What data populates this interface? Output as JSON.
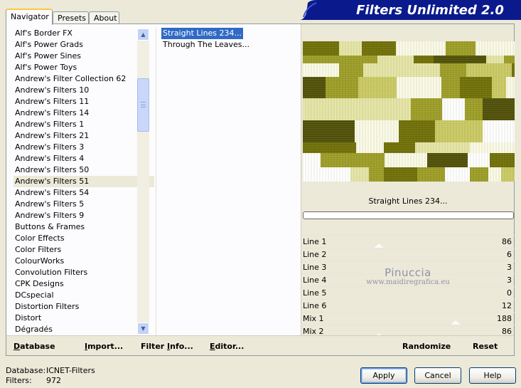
{
  "app": {
    "title": "Filters Unlimited 2.0"
  },
  "tabs": [
    {
      "label": "Navigator",
      "active": true
    },
    {
      "label": "Presets",
      "active": false
    },
    {
      "label": "About",
      "active": false
    }
  ],
  "filters": {
    "selected": "Andrew's Filters 51",
    "items": [
      "Alf's Border FX",
      "Alf's Power Grads",
      "Alf's Power Sines",
      "Alf's Power Toys",
      "Andrew's Filter Collection 62",
      "Andrew's Filters 10",
      "Andrew's Filters 11",
      "Andrew's Filters 14",
      "Andrew's Filters 1",
      "Andrew's Filters 21",
      "Andrew's Filters 3",
      "Andrew's Filters 4",
      "Andrew's Filters 50",
      "Andrew's Filters 51",
      "Andrew's Filters 54",
      "Andrew's Filters 5",
      "Andrew's Filters 9",
      "Buttons & Frames",
      "Color Effects",
      "Color Filters",
      "ColourWorks",
      "Convolution Filters",
      "CPK Designs",
      "DCspecial",
      "Distortion Filters",
      "Distort",
      "Dégradés"
    ]
  },
  "effects": {
    "selected": "Straight Lines 234...",
    "items": [
      "Straight Lines 234...",
      "Through The Leaves..."
    ]
  },
  "preview": {
    "label": "Straight Lines 234...",
    "progress": 0,
    "palette": [
      "#6b6b00",
      "#9a9a20",
      "#c8c860",
      "#e4e4a4",
      "#fafae6",
      "#ffffff",
      "#4a4a00"
    ]
  },
  "params": [
    {
      "name": "Line 1",
      "value": "86",
      "level": 0.337
    },
    {
      "name": "Line 2",
      "value": "6",
      "level": 0.024
    },
    {
      "name": "Line 3",
      "value": "3",
      "level": 0.012
    },
    {
      "name": "Line 4",
      "value": "3",
      "level": 0.012
    },
    {
      "name": "Line 5",
      "value": "0",
      "level": 0.0
    },
    {
      "name": "Line 6",
      "value": "12",
      "level": 0.047
    },
    {
      "name": "Mix 1",
      "value": "188",
      "level": 0.737
    },
    {
      "name": "Mix 2",
      "value": "86",
      "level": 0.337
    }
  ],
  "watermark": {
    "name": "Pinuccia",
    "url": "www.maidiregrafica.eu"
  },
  "toolbar": {
    "database": "atabase",
    "database_u": "D",
    "import": "mport...",
    "import_u": "I",
    "filter_info_pre": "Filter ",
    "filter_info_u": "I",
    "filter_info_post": "nfo...",
    "editor_u": "E",
    "editor": "ditor...",
    "randomize": "Randomize",
    "reset": "Reset"
  },
  "status": {
    "database_label": "Database:",
    "database_value": "ICNET-Filters",
    "filters_label": "Filters:",
    "filters_value": "972"
  },
  "buttons": {
    "apply": "Apply",
    "cancel": "Cancel",
    "help": "Help"
  }
}
